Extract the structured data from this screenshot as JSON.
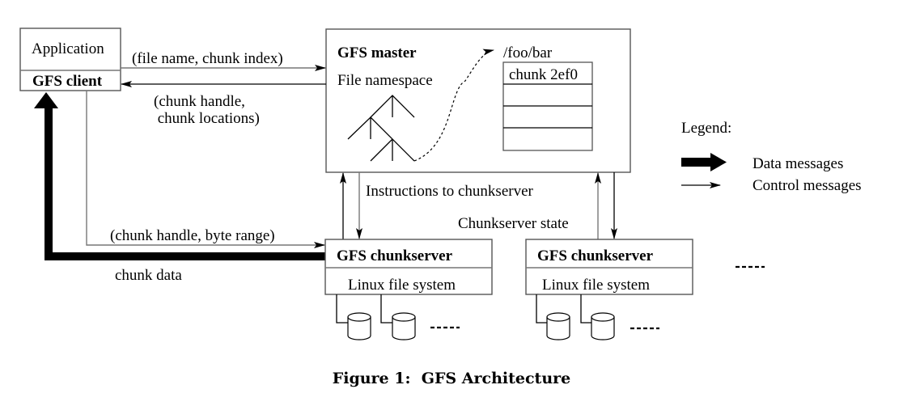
{
  "diagram": {
    "client": {
      "application_label": "Application",
      "client_label": "GFS client"
    },
    "master": {
      "title": "GFS master",
      "namespace_label": "File namespace",
      "file_path": "/foo/bar",
      "chunk_table": [
        "chunk 2ef0",
        "",
        "",
        ""
      ]
    },
    "messages": {
      "request": "(file name, chunk index)",
      "reply_line1": "(chunk handle,",
      "reply_line2": " chunk locations)",
      "instructions": "Instructions to chunkserver",
      "state": "Chunkserver state",
      "read_request": "(chunk handle, byte range)",
      "chunk_data": "chunk data"
    },
    "chunkservers": [
      {
        "title": "GFS chunkserver",
        "fs_label": "Linux file system",
        "more_disks": "....."
      },
      {
        "title": "GFS chunkserver",
        "fs_label": "Linux file system",
        "more_disks": "....."
      }
    ],
    "more_chunkservers": ".....",
    "legend": {
      "title": "Legend:",
      "items": [
        {
          "icon": "thick-arrow-icon",
          "label": "Data messages"
        },
        {
          "icon": "thin-arrow-icon",
          "label": "Control messages"
        }
      ]
    }
  },
  "caption": "Figure 1:  GFS Architecture"
}
